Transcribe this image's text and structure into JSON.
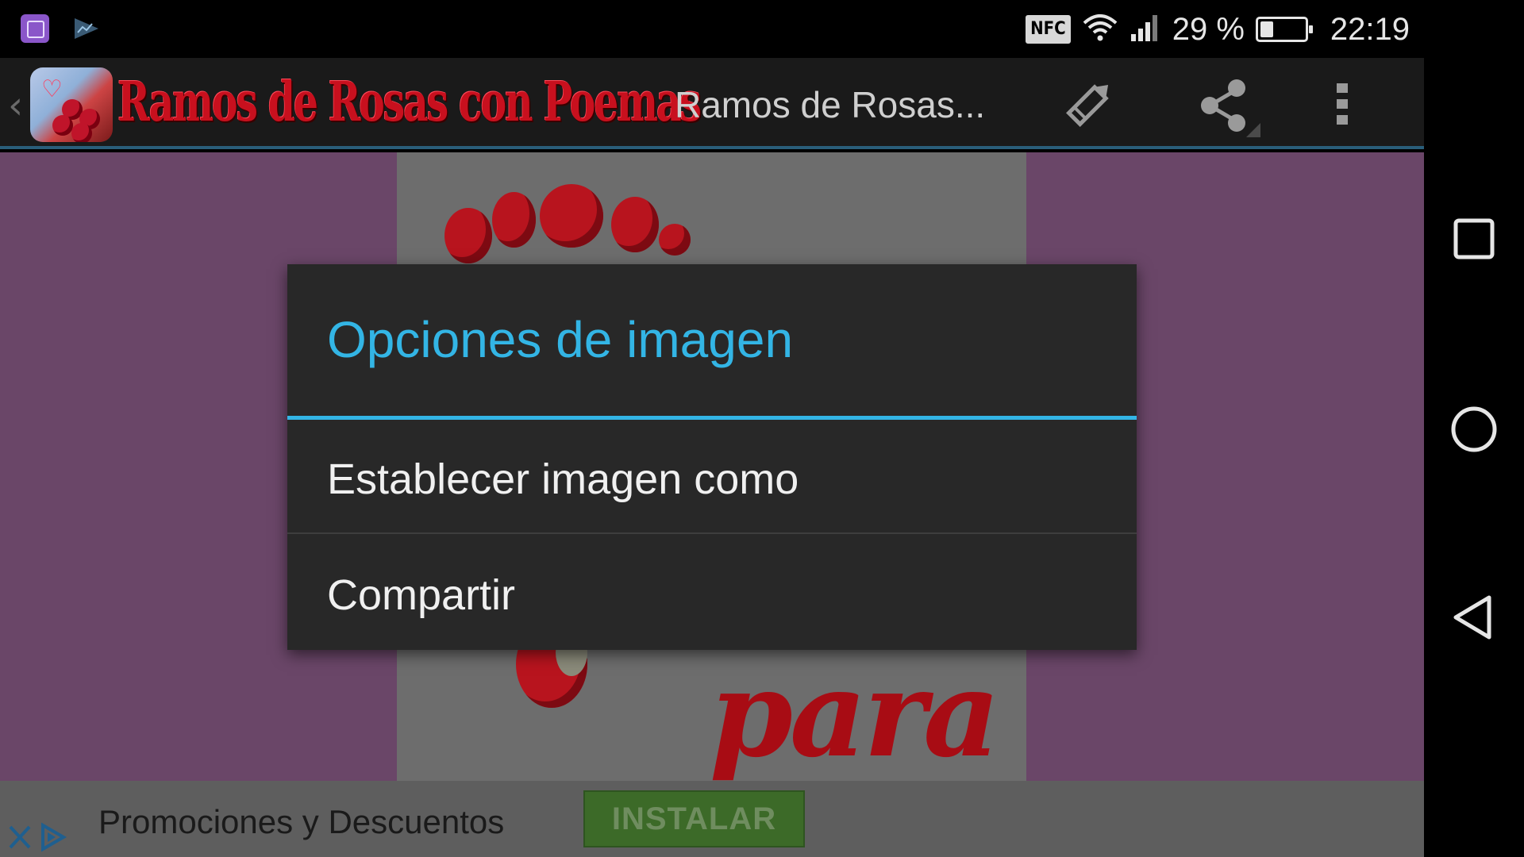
{
  "status_bar": {
    "notifications": [
      "gallery-icon",
      "play-store-icon"
    ],
    "nfc_label": "NFC",
    "battery_percent_text": "29 %",
    "battery_level": 0.29,
    "time": "22:19"
  },
  "app_bar": {
    "brand_title": "Ramos de Rosas con Poemas",
    "subtitle": "Ramos de Rosas...",
    "actions": [
      "pencil-icon",
      "share-icon",
      "overflow-menu-icon"
    ]
  },
  "content": {
    "image_caption": "para ti!",
    "colors": {
      "page_background": "#6a4668",
      "image_background": "#6d6d6d"
    }
  },
  "dialog": {
    "title": "Opciones de imagen",
    "items": [
      {
        "label": "Establecer imagen como"
      },
      {
        "label": "Compartir"
      }
    ],
    "accent": "#33b5e5"
  },
  "ad": {
    "text": "Promociones y Descuentos",
    "button_label": "INSTALAR"
  },
  "nav_bar": {
    "buttons": [
      "recents-icon",
      "home-icon",
      "back-icon"
    ]
  }
}
